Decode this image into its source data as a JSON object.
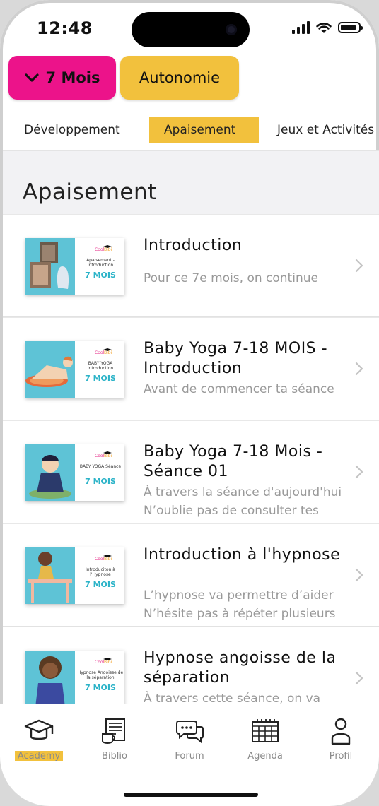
{
  "status": {
    "time": "12:48"
  },
  "header": {
    "month_button": "7 Mois",
    "autonomy_button": "Autonomie"
  },
  "tabs": [
    {
      "label": "Développement"
    },
    {
      "label": "Apaisement"
    },
    {
      "label": "Jeux et Activités"
    }
  ],
  "section_title": "Apaisement",
  "items": [
    {
      "title": "Introduction",
      "subtitles": [
        "Pour ce 7e mois, on continue"
      ],
      "thumb_caption": "Apaisement - Introduction",
      "thumb_mois": "7 MOIS"
    },
    {
      "title": "Baby Yoga 7-18 MOIS - Introduction",
      "subtitles": [
        "Avant de commencer ta séance"
      ],
      "thumb_caption": "BABY YOGA Introduction",
      "thumb_mois": "7 MOIS"
    },
    {
      "title": "Baby Yoga 7-18 Mois - Séance 01",
      "subtitles": [
        "À travers la séance d'aujourd'hui",
        "N’oublie pas de consulter tes"
      ],
      "thumb_caption": "BABY YOGA Séance",
      "thumb_mois": "7 MOIS"
    },
    {
      "title": "Introduction à l'hypnose",
      "subtitles": [
        "L’hypnose va permettre d’aider",
        "N’hésite pas à répéter plusieurs"
      ],
      "thumb_caption": "Introduciton à l'Hypnose",
      "thumb_mois": "7 MOIS"
    },
    {
      "title": "Hypnose angoisse de la séparation",
      "subtitles": [
        "À travers cette séance, on va"
      ],
      "thumb_caption": "Hypnose Angoisse de la séparation",
      "thumb_mois": "7 MOIS"
    }
  ],
  "tabbar": [
    {
      "label": "Academy",
      "icon": "graduation-cap-icon"
    },
    {
      "label": "Biblio",
      "icon": "newspaper-coffee-icon"
    },
    {
      "label": "Forum",
      "icon": "chat-bubbles-icon"
    },
    {
      "label": "Agenda",
      "icon": "calendar-icon"
    },
    {
      "label": "Profil",
      "icon": "user-icon"
    }
  ],
  "colors": {
    "pink": "#ec138a",
    "yellow": "#f2c13d",
    "thumb_blue": "#5ec3d6",
    "thumb_mois": "#2bb3c8"
  }
}
